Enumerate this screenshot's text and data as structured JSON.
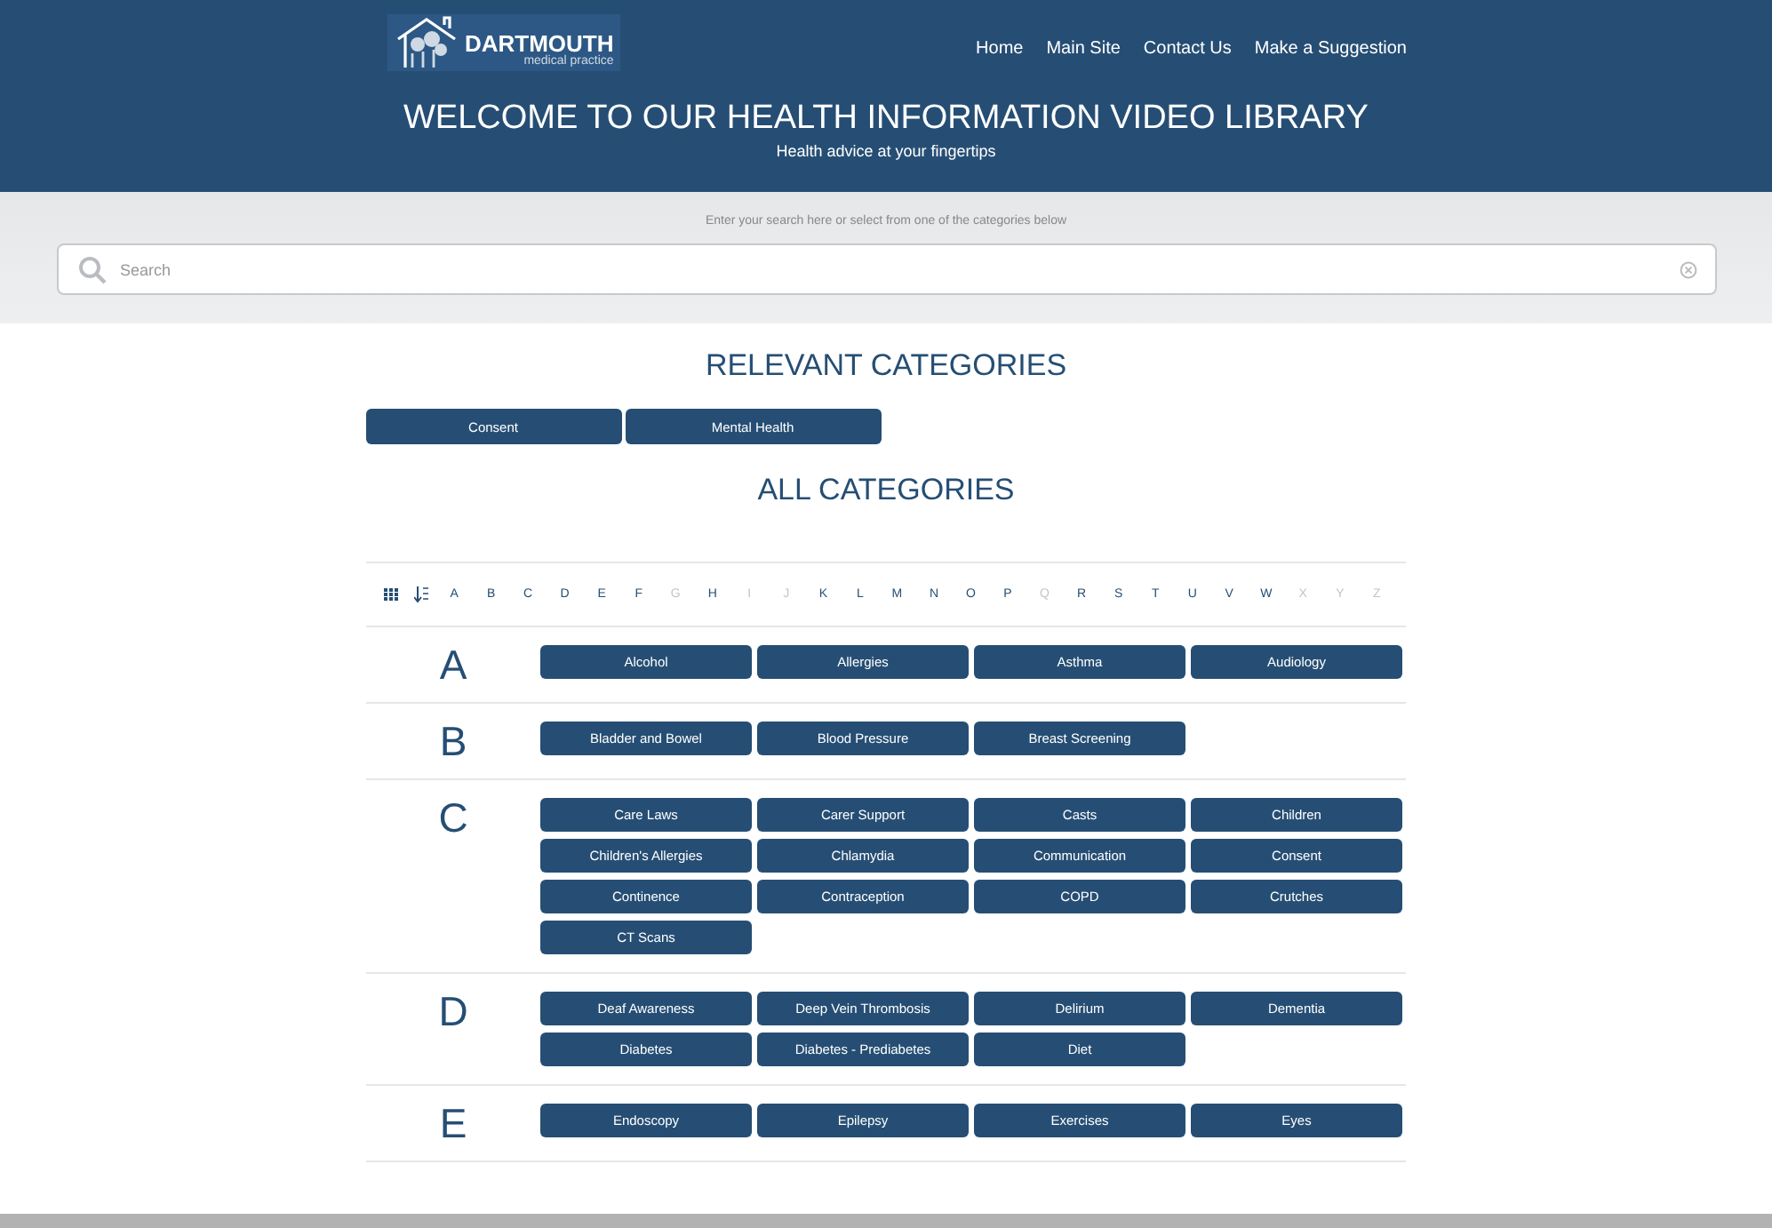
{
  "logo": {
    "name": "DARTMOUTH",
    "tagline": "medical practice"
  },
  "nav": [
    "Home",
    "Main Site",
    "Contact Us",
    "Make a Suggestion"
  ],
  "hero": {
    "title": "WELCOME TO OUR HEALTH INFORMATION VIDEO LIBRARY",
    "subtitle": "Health advice at your fingertips"
  },
  "search": {
    "hint": "Enter your search here or select from one of the categories below",
    "placeholder": "Search"
  },
  "relevant": {
    "heading": "RELEVANT CATEGORIES",
    "items": [
      "Consent",
      "Mental Health"
    ]
  },
  "all": {
    "heading": "ALL CATEGORIES",
    "letters": [
      {
        "label": "A",
        "disabled": false
      },
      {
        "label": "B",
        "disabled": false
      },
      {
        "label": "C",
        "disabled": false
      },
      {
        "label": "D",
        "disabled": false
      },
      {
        "label": "E",
        "disabled": false
      },
      {
        "label": "F",
        "disabled": false
      },
      {
        "label": "G",
        "disabled": true
      },
      {
        "label": "H",
        "disabled": false
      },
      {
        "label": "I",
        "disabled": true
      },
      {
        "label": "J",
        "disabled": true
      },
      {
        "label": "K",
        "disabled": false
      },
      {
        "label": "L",
        "disabled": false
      },
      {
        "label": "M",
        "disabled": false
      },
      {
        "label": "N",
        "disabled": false
      },
      {
        "label": "O",
        "disabled": false
      },
      {
        "label": "P",
        "disabled": false
      },
      {
        "label": "Q",
        "disabled": true
      },
      {
        "label": "R",
        "disabled": false
      },
      {
        "label": "S",
        "disabled": false
      },
      {
        "label": "T",
        "disabled": false
      },
      {
        "label": "U",
        "disabled": false
      },
      {
        "label": "V",
        "disabled": false
      },
      {
        "label": "W",
        "disabled": false
      },
      {
        "label": "X",
        "disabled": true
      },
      {
        "label": "Y",
        "disabled": true
      },
      {
        "label": "Z",
        "disabled": true
      }
    ],
    "groups": [
      {
        "letter": "A",
        "items": [
          "Alcohol",
          "Allergies",
          "Asthma",
          "Audiology"
        ]
      },
      {
        "letter": "B",
        "items": [
          "Bladder and Bowel",
          "Blood Pressure",
          "Breast Screening"
        ]
      },
      {
        "letter": "C",
        "items": [
          "Care Laws",
          "Carer Support",
          "Casts",
          "Children",
          "Children's Allergies",
          "Chlamydia",
          "Communication",
          "Consent",
          "Continence",
          "Contraception",
          "COPD",
          "Crutches",
          "CT Scans"
        ]
      },
      {
        "letter": "D",
        "items": [
          "Deaf Awareness",
          "Deep Vein Thrombosis",
          "Delirium",
          "Dementia",
          "Diabetes",
          "Diabetes - Prediabetes",
          "Diet"
        ]
      },
      {
        "letter": "E",
        "items": [
          "Endoscopy",
          "Epilepsy",
          "Exercises",
          "Eyes"
        ]
      }
    ]
  }
}
